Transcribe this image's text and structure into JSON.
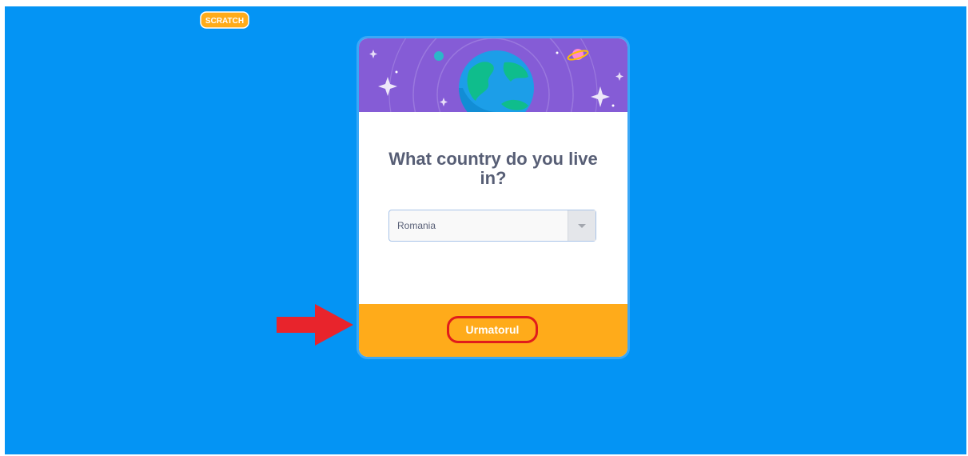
{
  "brand": {
    "logo_text": "SCRATCH",
    "logo_color": "#ffab1a"
  },
  "colors": {
    "background": "#0494f4",
    "banner": "#855cd6",
    "footer": "#ffab1a",
    "highlight": "#e01c1c"
  },
  "modal": {
    "question": "What country do you live in?",
    "country_select": {
      "value": "Romania"
    },
    "next_button_label": "Urmatorul"
  },
  "icons": {
    "banner": "globe-icon",
    "dropdown": "chevron-down-icon",
    "annotation": "red-arrow-icon"
  }
}
